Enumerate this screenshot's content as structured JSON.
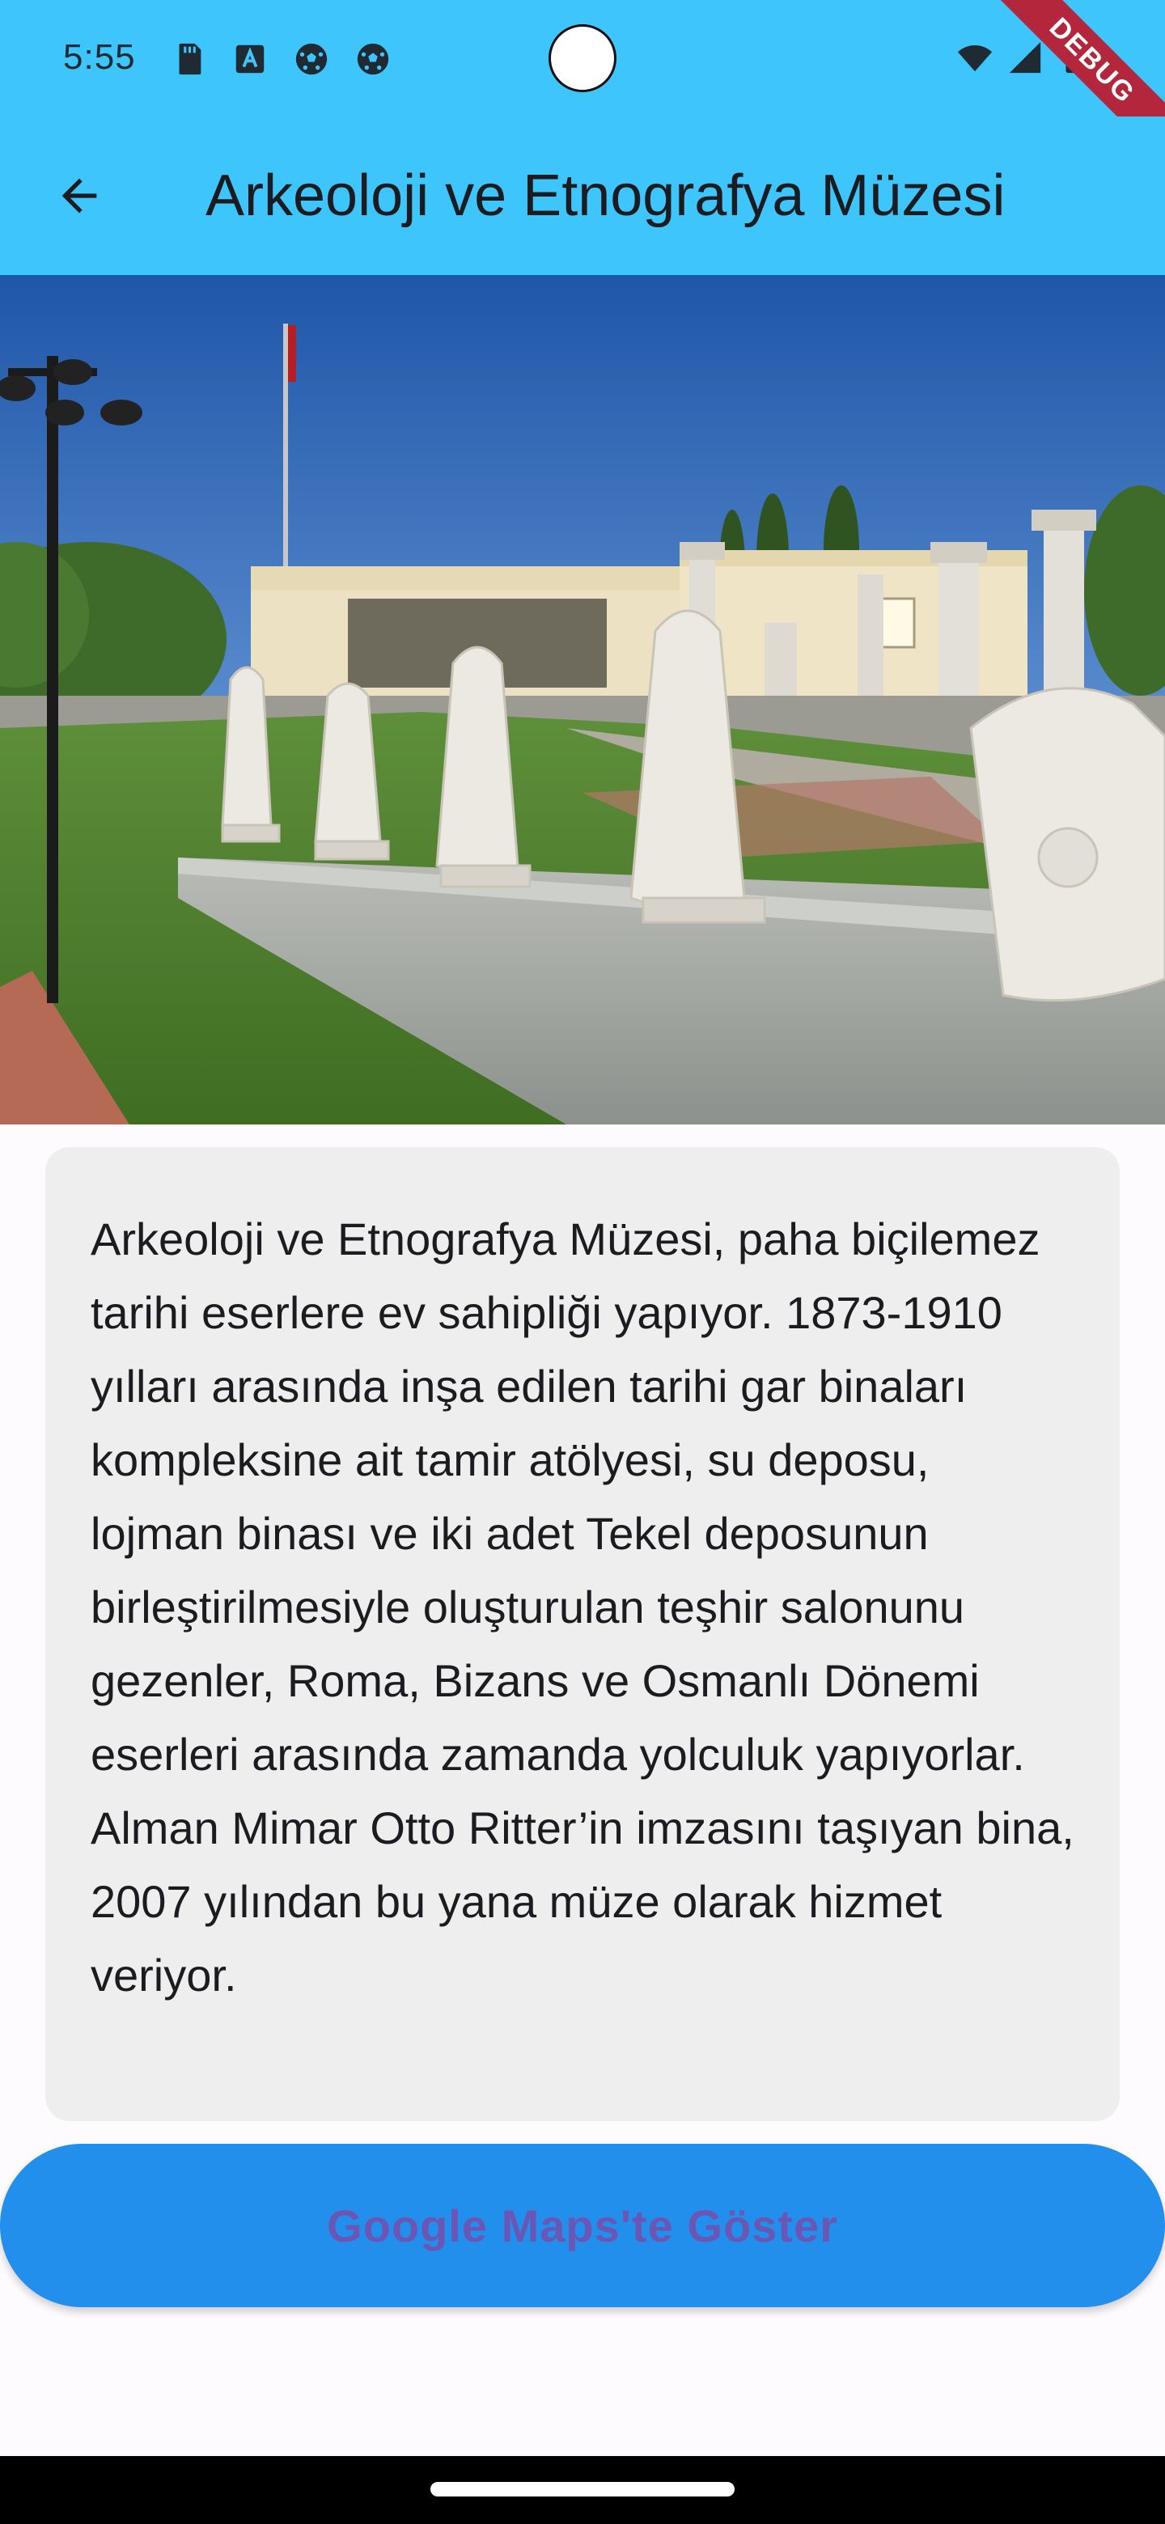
{
  "status_bar": {
    "time": "5:55",
    "left_icons": [
      "sd-card-icon",
      "text-a-icon",
      "soccer-ball-icon",
      "soccer-ball-icon"
    ],
    "right_icons": [
      "wifi-icon",
      "signal-icon",
      "battery-icon"
    ]
  },
  "debug_banner": "DEBUG",
  "app_bar": {
    "back_icon": "arrow-back-icon",
    "title": "Arkeoloji ve Etnografya Müzesi",
    "background": "#3ec6fc"
  },
  "hero_image": {
    "subject": "museum-building-with-headless-statues-and-columns"
  },
  "description": "Arkeoloji ve Etnografya Müzesi, paha biçilemez tarihi eserlere ev sahipliği yapıyor. 1873-1910 yılları arasında inşa edilen tarihi gar binaları kompleksine ait tamir atölyesi, su deposu, lojman binası ve iki adet Tekel deposunun birleştirilmesiyle oluşturulan teşhir salonunu gezenler, Roma, Bizans ve Osmanlı Dönemi eserleri arasında zamanda yolculuk yapıyorlar. Alman Mimar Otto Ritter’in imzasını taşıyan bina, 2007 yılından bu yana müze olarak hizmet veriyor.",
  "maps_button": {
    "label": "Google Maps'te Göster",
    "background": "#238fed",
    "text_color": "#6c56b3"
  }
}
